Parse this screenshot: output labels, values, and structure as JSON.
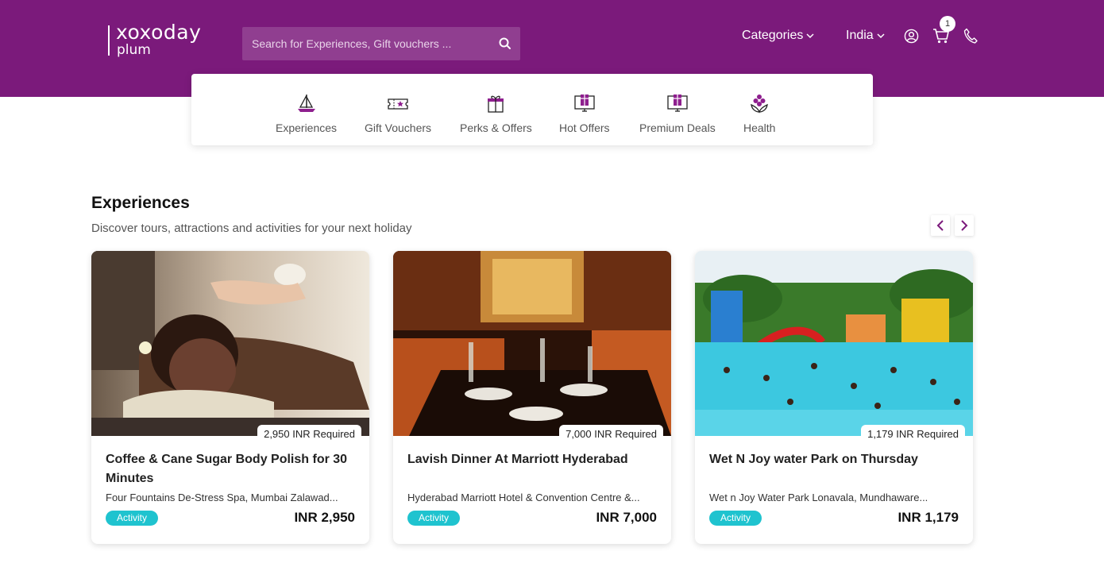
{
  "colors": {
    "header_bg": "#7b1a7b",
    "accent": "#7b1a7b",
    "tag_bg": "#1fc3cf"
  },
  "header": {
    "logo_top": "xoxoday",
    "logo_bottom": "plum",
    "search_placeholder": "Search for Experiences, Gift vouchers ...",
    "categories_label": "Categories",
    "country_label": "India",
    "cart_count": "1",
    "icons": [
      "search-icon",
      "user-icon",
      "cart-icon",
      "phone-icon"
    ]
  },
  "categories": [
    {
      "label": "Experiences",
      "icon": "sailboat-icon"
    },
    {
      "label": "Gift Vouchers",
      "icon": "ticket-icon"
    },
    {
      "label": "Perks & Offers",
      "icon": "gift-icon"
    },
    {
      "label": "Hot Offers",
      "icon": "gift-screen-icon"
    },
    {
      "label": "Premium Deals",
      "icon": "gift-screen-icon"
    },
    {
      "label": "Health",
      "icon": "lotus-icon"
    }
  ],
  "section": {
    "title": "Experiences",
    "subtitle": "Discover tours, attractions and activities for your next holiday"
  },
  "cards": [
    {
      "required": "2,950 INR Required",
      "title": "Coffee & Cane Sugar Body Polish for 30 Minutes",
      "location": "Four Fountains De-Stress Spa, Mumbai Zalawad...",
      "tag": "Activity",
      "price": "INR 2,950",
      "image": "spa-massage-photo"
    },
    {
      "required": "7,000 INR Required",
      "title": "Lavish Dinner At Marriott Hyderabad",
      "location": "Hyderabad Marriott Hotel & Convention Centre &...",
      "tag": "Activity",
      "price": "INR 7,000",
      "image": "restaurant-dining-photo"
    },
    {
      "required": "1,179 INR Required",
      "title": "Wet N Joy water Park on Thursday",
      "location": "Wet n Joy Water Park Lonavala, Mundhaware...",
      "tag": "Activity",
      "price": "INR 1,179",
      "image": "water-park-photo"
    }
  ]
}
